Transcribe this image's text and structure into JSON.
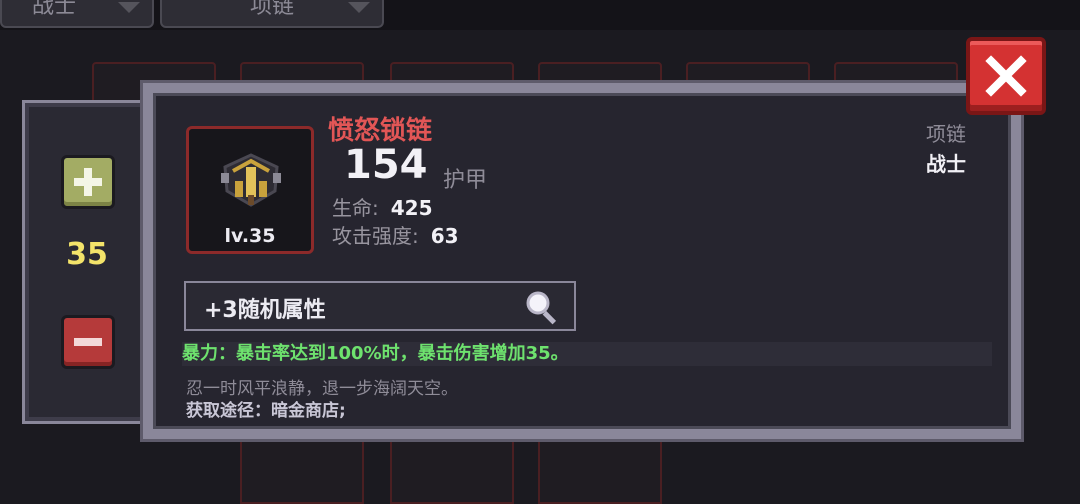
{
  "filters": {
    "class_label": "战士",
    "slot_label": "项链"
  },
  "stepper": {
    "plus_icon": "plus-icon",
    "minus_icon": "minus-icon",
    "quantity": "35"
  },
  "item": {
    "name": "愤怒锁链",
    "level": "lv.35",
    "armor_value": "154",
    "armor_label": "护甲",
    "stats": [
      {
        "label": "生命:",
        "value": "425"
      },
      {
        "label": "攻击强度:",
        "value": "63"
      }
    ],
    "slot": "项链",
    "class": "战士",
    "random_attr": "+3随机属性",
    "effect": "暴力：暴击率达到100%时，暴击伤害增加35。",
    "flavor": "忍一时风平浪静，退一步海阔天空。",
    "source": "获取途径：暗金商店;"
  },
  "colors": {
    "name": "#e25656",
    "effect": "#6ee26e",
    "quantity": "#f3e36a",
    "close": "#d43232"
  }
}
